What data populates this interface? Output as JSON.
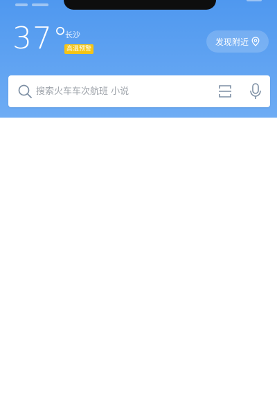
{
  "header": {
    "temperature": "37°",
    "city": "长沙",
    "alert_badge": "高温预警",
    "nearby_button_label": "发现附近",
    "nearby_icon": "location-pin-icon"
  },
  "search": {
    "placeholder": "搜索火车车次航班 小说",
    "icon": "search-icon",
    "scan_icon": "scan-icon",
    "mic_icon": "microphone-icon"
  },
  "colors": {
    "header_gradient_top": "#4f98ef",
    "header_gradient_bottom": "#6eacf4",
    "alert_badge_bg": "#f5c416",
    "icon_gray": "#7c8ea3"
  }
}
